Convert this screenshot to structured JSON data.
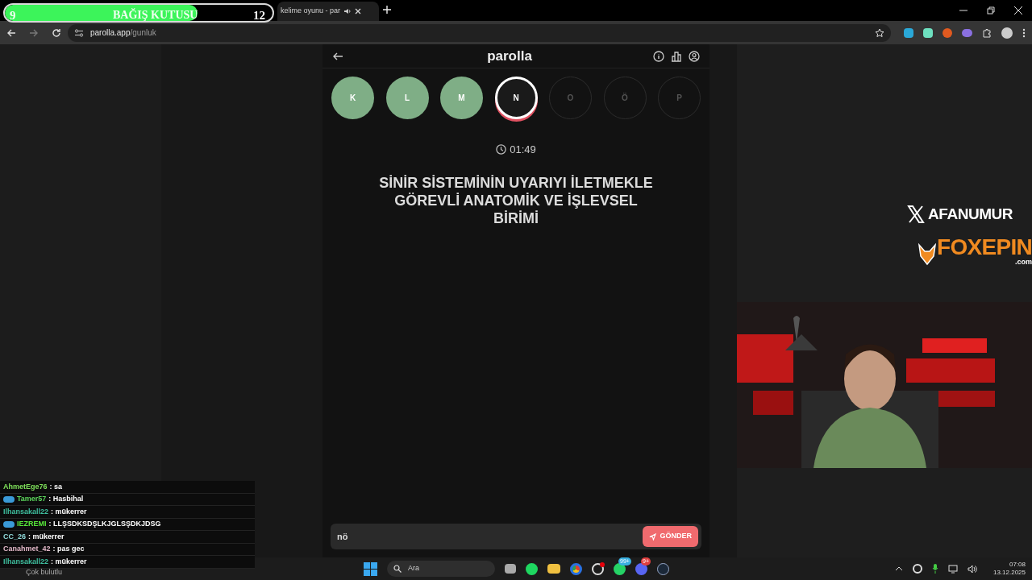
{
  "donation_bar": {
    "current": "9",
    "title": "BAĞIŞ KUTUSU",
    "goal": "12",
    "level": 0.72
  },
  "tab": {
    "title": "kelime oyunu - par"
  },
  "address_bar": {
    "host": "parolla.app",
    "path": "/gunluk"
  },
  "game": {
    "title": "parolla",
    "letters": [
      {
        "letter": "K",
        "kind": "correct"
      },
      {
        "letter": "L",
        "kind": "correct"
      },
      {
        "letter": "M",
        "kind": "correct"
      },
      {
        "letter": "N",
        "kind": "current"
      },
      {
        "letter": "O",
        "kind": "pending"
      },
      {
        "letter": "Ö",
        "kind": "pending"
      },
      {
        "letter": "P",
        "kind": "pending"
      }
    ],
    "timer": "01:49",
    "question": "SİNİR SİSTEMİNİN UYARIYI İLETMEKLE GÖREVLİ ANATOMİK VE İŞLEVSEL BİRİMİ",
    "answer": "nö",
    "submit": "GÖNDER"
  },
  "overlay": {
    "handle": "AFANUMUR",
    "sponsor": "FOXEPIN",
    "sponsor_suffix": ".com"
  },
  "chat": [
    {
      "user": "AhmetEge76",
      "color": "#7ee05a",
      "message": ": sa",
      "badges": false
    },
    {
      "user": "Tamer57",
      "color": "#5cd65c",
      "message": ": Hasbihal",
      "badges": true
    },
    {
      "user": "Ilhansakall22",
      "color": "#3fbf9f",
      "message": ": mükerrer",
      "badges": false
    },
    {
      "user": "IEZREMI",
      "color": "#58e83a",
      "message": ": LLŞSDKSDŞLKJGLSŞDKJDSG",
      "badges": true
    },
    {
      "user": "CC_26",
      "color": "#8fd8d8",
      "message": ": mükerrer",
      "badges": false
    },
    {
      "user": "Canahmet_42",
      "color": "#e2b8c8",
      "message": ": pas gec",
      "badges": false
    },
    {
      "user": "Ilhansakall22",
      "color": "#3fbf9f",
      "message": ": mükerrer",
      "badges": false
    }
  ],
  "taskbar": {
    "weather": "Çok bulutlu",
    "search_placeholder": "Ara",
    "whatsapp_badge": "99+",
    "discord_badge": "9+",
    "time": "07:08",
    "date": "13.12.2025"
  }
}
